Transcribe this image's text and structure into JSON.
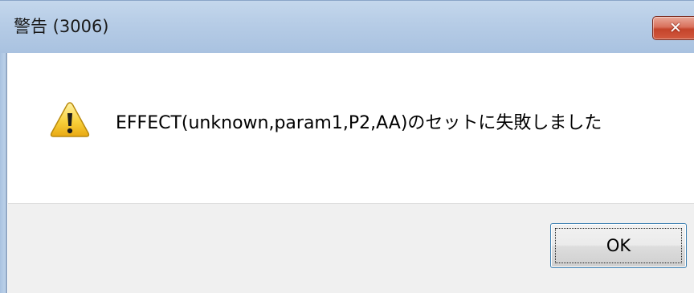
{
  "window": {
    "title": "警告 (3006)",
    "close_glyph": "✕"
  },
  "dialog": {
    "icon": "warning-icon",
    "message": "EFFECT(unknown,param1,P2,AA)のセットに失敗しました"
  },
  "buttons": {
    "ok_label": "OK"
  },
  "colors": {
    "titlebar": "#b6cce6",
    "close_button": "#c4442b",
    "footer": "#f0f0f0",
    "warning_yellow": "#f5c518"
  }
}
